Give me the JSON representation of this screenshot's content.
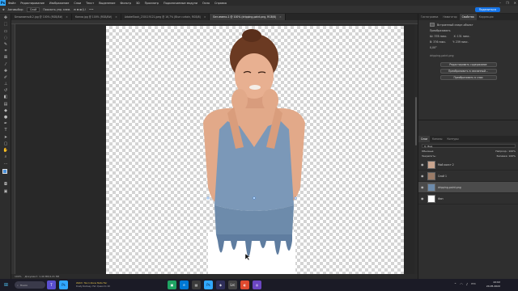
{
  "app": {
    "logo": "Ps"
  },
  "menu": [
    "Файл",
    "Редактирование",
    "Изображение",
    "Слои",
    "Текст",
    "Выделение",
    "Фильтр",
    "3D",
    "Просмотр",
    "Подключаемые модули",
    "Окно",
    "Справка"
  ],
  "window_controls": [
    "–",
    "❐",
    "✕"
  ],
  "options": {
    "mode_label": "Автовыбор:",
    "mode_value": "Слой",
    "transform_label": "Показать упр. элем.",
    "share_label": "Поделиться"
  },
  "tabs": [
    {
      "label": "Безымянный-2.jpg @ 100% (RGB/8#)",
      "active": false
    },
    {
      "label": "Капли.jpg @ 100% (RGB/8#)",
      "active": false
    },
    {
      "label": "AdobeStock_230119121.jpeg @ 16,7% (Blue curtain, RGB/8)",
      "active": false
    },
    {
      "label": "Без имени-1 @ 100% (dripping-paint.png, RGB/8)",
      "active": true
    }
  ],
  "status": {
    "zoom": "100%",
    "doc": "Документ: 1,49 Мб/4,21 Мб"
  },
  "panel_tabs": [
    "Гистограмма",
    "Навигатор",
    "Свойства",
    "Коррекция"
  ],
  "properties": {
    "layer_type": "Встроенный смарт-объект",
    "section": "Преобразовать",
    "w": "Ш: 378 пикс.",
    "h": "В: 376 пикс.",
    "x": "X: 131 пикс.",
    "y": "Y: 239 пикс.",
    "angle": "0,00°",
    "file": "dripping-paint.png",
    "btn1": "Редактировать содержимое",
    "btn2": "Преобразовать в связанный...",
    "btn3": "Преобразовать в слои"
  },
  "layers_panel": {
    "tabs": [
      "Слои",
      "Каналы",
      "Контуры"
    ],
    "search": "Q. Вид",
    "blend": "Обычные",
    "opacity": "Непрозр.: 100%",
    "lock": "Закрепить:",
    "fill": "Заливка: 100%",
    "layers": [
      {
        "name": "Мой холст 2",
        "selected": false
      },
      {
        "name": "Слой 1",
        "selected": false
      },
      {
        "name": "dripping-paint.png",
        "selected": true
      },
      {
        "name": "Фон",
        "selected": false
      }
    ]
  },
  "taskbar": {
    "search_placeholder": "Поиск",
    "news_title": "Watch: Two Indiana State Fair",
    "news_sub": "Dusty Ramsey, Fair Queen to 20",
    "time": "22:02",
    "date": "24.05.2022",
    "lang": "РУС"
  },
  "colors": {
    "accent": "#1473e6",
    "ps_blue": "#31a8ff",
    "shirt": "#7b98b8",
    "skin": "#e2a989"
  }
}
